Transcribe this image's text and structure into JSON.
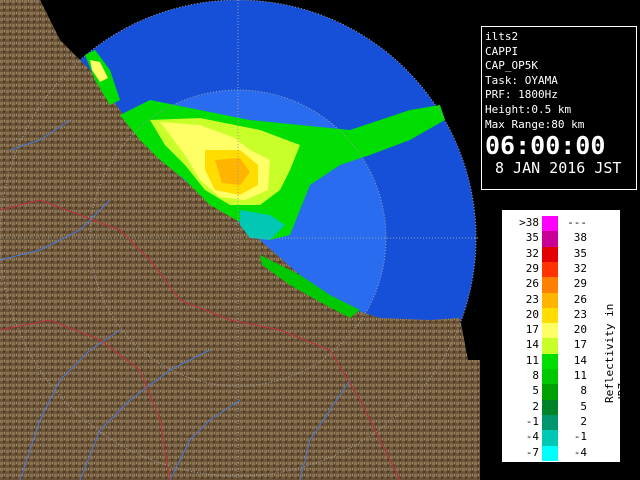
{
  "map": {
    "title": "radar-reflectivity-map"
  },
  "info": {
    "station": "ilts2",
    "product": "CAPPI",
    "task_id": "CAP_OP5K",
    "task": "Task: OYAMA",
    "prf": "PRF: 1800Hz",
    "height": "Height:0.5 km",
    "max_range": "Max Range:80 km",
    "time": "06:00:00",
    "date": "8 JAN 2016 JST"
  },
  "legend": {
    "title": "Reflectivity in dBZ",
    "rows": [
      {
        "lo": ">38",
        "hi": "---",
        "color": "#ff00ff"
      },
      {
        "lo": "35",
        "hi": "38",
        "color": "#c80096"
      },
      {
        "lo": "32",
        "hi": "35",
        "color": "#e40000"
      },
      {
        "lo": "29",
        "hi": "32",
        "color": "#ff3300"
      },
      {
        "lo": "26",
        "hi": "29",
        "color": "#ff7f00"
      },
      {
        "lo": "23",
        "hi": "26",
        "color": "#ffb400"
      },
      {
        "lo": "20",
        "hi": "23",
        "color": "#ffdd00"
      },
      {
        "lo": "17",
        "hi": "20",
        "color": "#ffff66"
      },
      {
        "lo": "14",
        "hi": "17",
        "color": "#c8ff28"
      },
      {
        "lo": "11",
        "hi": "14",
        "color": "#00dd00"
      },
      {
        "lo": "8",
        "hi": "11",
        "color": "#00c800"
      },
      {
        "lo": "5",
        "hi": "8",
        "color": "#00a000"
      },
      {
        "lo": "2",
        "hi": "5",
        "color": "#008228"
      },
      {
        "lo": "-1",
        "hi": "2",
        "color": "#00966e"
      },
      {
        "lo": "-4",
        "hi": "-1",
        "color": "#00c8b4"
      },
      {
        "lo": "-7",
        "hi": "-4",
        "color": "#00ffff"
      }
    ]
  },
  "colors": {
    "sea_far": "#1650d8",
    "sea_near": "#2a6cf0",
    "land": "#6b5438",
    "range_ring": "#9aa0a8",
    "border": "#c03040",
    "river": "#4a78d8"
  }
}
